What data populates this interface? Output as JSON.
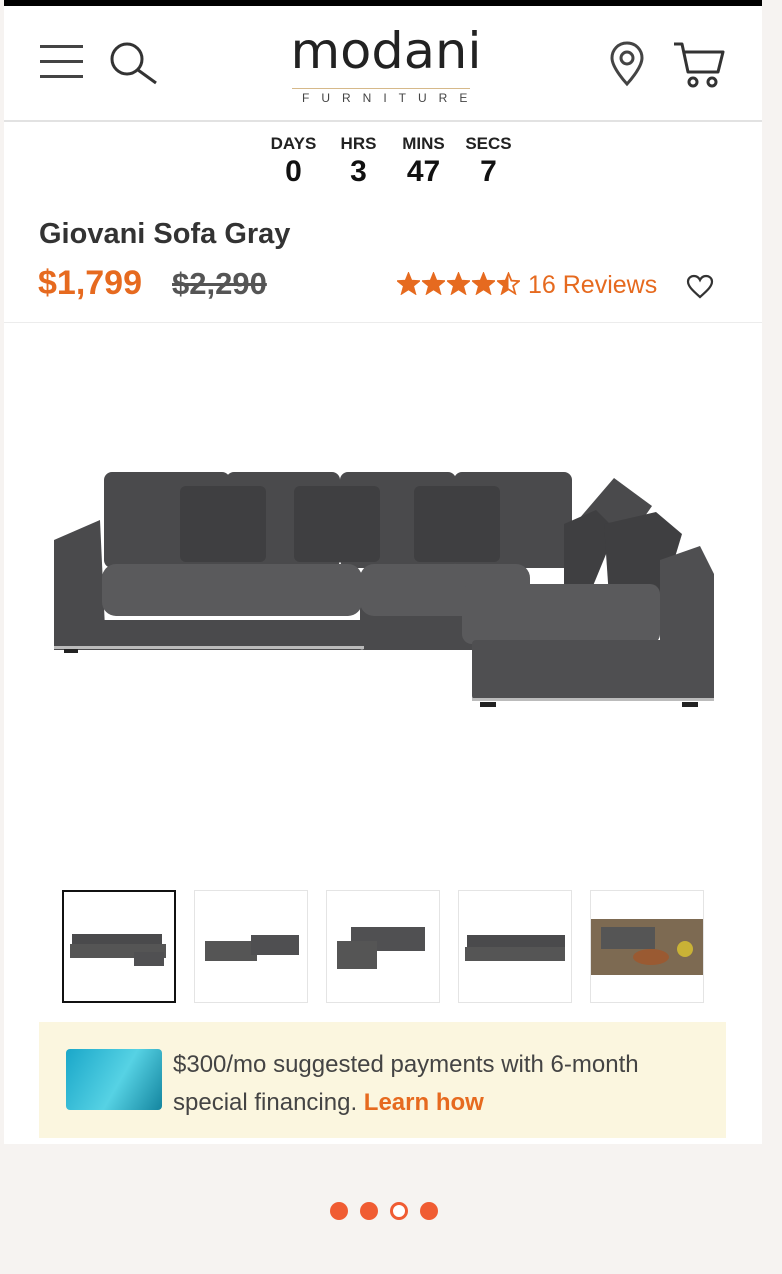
{
  "header": {
    "brand_name": "modani",
    "brand_subtitle": "FURNITURE",
    "menu_icon": "hamburger-icon",
    "search_icon": "search-icon",
    "location_icon": "location-pin-icon",
    "cart_icon": "cart-icon"
  },
  "countdown": {
    "days_label": "DAYS",
    "days_value": "0",
    "hrs_label": "HRS",
    "hrs_value": "3",
    "mins_label": "MINS",
    "mins_value": "47",
    "secs_label": "SECS",
    "secs_value": "7"
  },
  "product": {
    "title": "Giovani Sofa Gray",
    "price": "$1,799",
    "original_price": "$2,290",
    "rating": 4.5,
    "reviews_label": "16 Reviews",
    "favorite_icon": "heart-icon"
  },
  "gallery": {
    "thumbnails": [
      "thumb-1",
      "thumb-2",
      "thumb-3",
      "thumb-4",
      "thumb-5"
    ],
    "active_index": 0
  },
  "financing": {
    "text": "$300/mo suggested payments with 6-month special financing.",
    "link": "Learn how"
  },
  "pagination": {
    "total": 4,
    "active_index": 2
  },
  "colors": {
    "accent": "#e66a1f",
    "dot": "#f05c33",
    "banner": "#fbf6df"
  }
}
